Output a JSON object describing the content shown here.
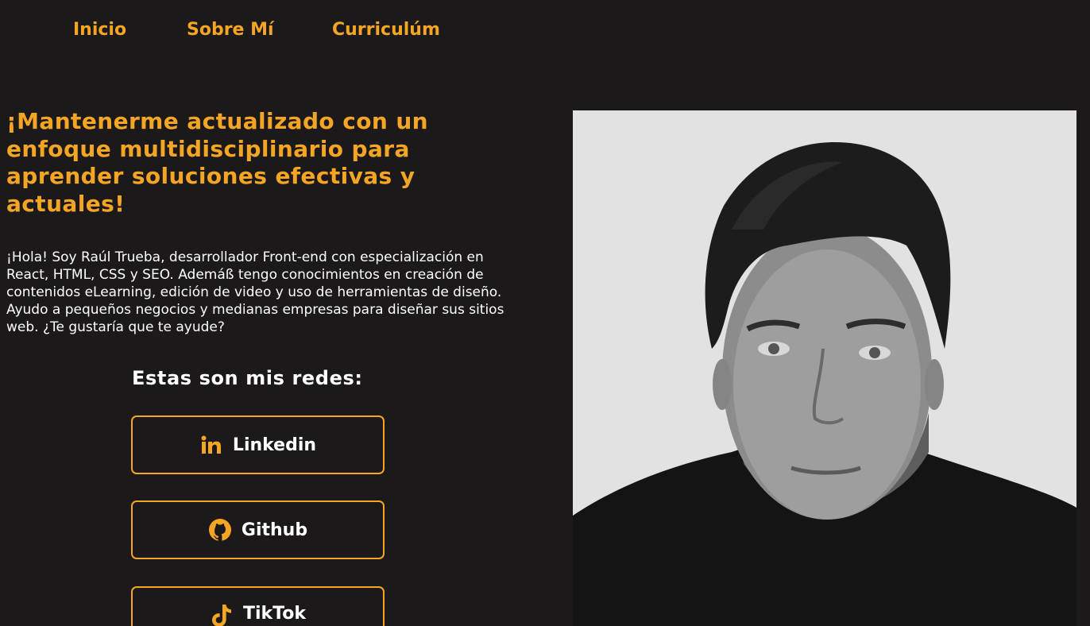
{
  "nav": {
    "items": [
      {
        "label": "Inicio"
      },
      {
        "label": "Sobre Mí"
      },
      {
        "label": "Curriculúm"
      }
    ]
  },
  "hero": {
    "headline": "¡Mantenerme actualizado con un enfoque multidisciplinario para aprender soluciones efectivas y actuales!",
    "intro": "¡Hola! Soy Raúl Trueba, desarrollador Front-end con especialización en React, HTML, CSS y SEO. Ademáß tengo conocimientos en creación de contenidos eLearning, edición de video y uso de herramientas de diseño. Ayudo a pequeños negocios y medianas empresas para diseñar sus sitios web. ¿Te gustaría que te ayude?"
  },
  "social": {
    "title": "Estas son mis redes:",
    "links": [
      {
        "label": "Linkedin",
        "icon": "linkedin-icon"
      },
      {
        "label": "Github",
        "icon": "github-icon"
      },
      {
        "label": "TikTok",
        "icon": "tiktok-icon"
      }
    ]
  },
  "photo": {
    "icon": "profile-photo"
  },
  "colors": {
    "background": "#1b191a",
    "accent": "#f5a524",
    "text": "#ffffff"
  }
}
